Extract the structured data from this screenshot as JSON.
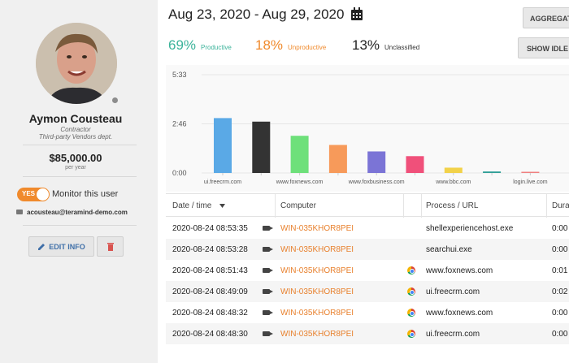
{
  "profile": {
    "name": "Aymon Cousteau",
    "role": "Contractor",
    "department": "Third-party Vendors dept.",
    "salary": "$85,000.00",
    "salary_period": "per year",
    "monitor_toggle": "YES",
    "monitor_label": "Monitor this user",
    "email": "acousteau@teramind-demo.com",
    "edit_label": "EDIT INFO"
  },
  "header": {
    "date_range": "Aug 23, 2020 - Aug 29, 2020",
    "aggregate_label": "AGGREGAT",
    "show_idle_label": "SHOW IDLE"
  },
  "stats": [
    {
      "value": "69%",
      "label": "Productive",
      "color": "#3bb39a"
    },
    {
      "value": "18%",
      "label": "Unproductive",
      "color": "#f08a2c"
    },
    {
      "value": "13%",
      "label": "Unclassified",
      "color": "#333333"
    }
  ],
  "chart_data": {
    "type": "bar",
    "y_ticks": [
      "5:33",
      "2:46",
      "0:00"
    ],
    "ylim": [
      0,
      333
    ],
    "categories": [
      "ui.freecrm.com",
      "",
      "www.foxnews.com",
      "",
      "www.foxbusiness.com",
      "",
      "www.bbc.com",
      "",
      "login.live.com"
    ],
    "values": [
      186,
      174,
      126,
      95,
      73,
      57,
      18,
      5,
      4
    ],
    "colors": [
      "#5aa9e6",
      "#333333",
      "#6ee07a",
      "#f79a5a",
      "#7b74d6",
      "#f0507a",
      "#f2d24a",
      "#2e9e96",
      "#f08080"
    ],
    "grid": true
  },
  "table": {
    "headers": [
      "Date / time",
      "Computer",
      "Process / URL",
      "Dura"
    ],
    "rows": [
      {
        "datetime": "2020-08-24 08:53:35",
        "computer": "WIN-035KHOR8PEI",
        "process": "shellexperiencehost.exe",
        "duration": "0:00",
        "browser": false
      },
      {
        "datetime": "2020-08-24 08:53:28",
        "computer": "WIN-035KHOR8PEI",
        "process": "searchui.exe",
        "duration": "0:00",
        "browser": false
      },
      {
        "datetime": "2020-08-24 08:51:43",
        "computer": "WIN-035KHOR8PEI",
        "process": "www.foxnews.com",
        "duration": "0:01",
        "browser": true
      },
      {
        "datetime": "2020-08-24 08:49:09",
        "computer": "WIN-035KHOR8PEI",
        "process": "ui.freecrm.com",
        "duration": "0:02",
        "browser": true
      },
      {
        "datetime": "2020-08-24 08:48:32",
        "computer": "WIN-035KHOR8PEI",
        "process": "www.foxnews.com",
        "duration": "0:00",
        "browser": true
      },
      {
        "datetime": "2020-08-24 08:48:30",
        "computer": "WIN-035KHOR8PEI",
        "process": "ui.freecrm.com",
        "duration": "0:00",
        "browser": true
      }
    ]
  }
}
